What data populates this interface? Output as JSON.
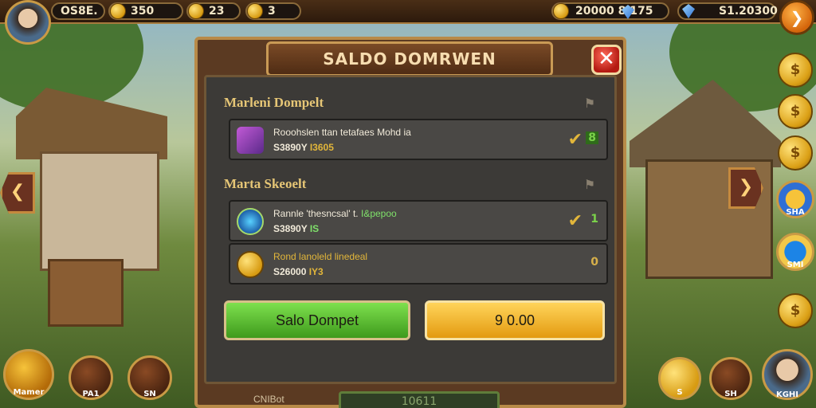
{
  "topbar": {
    "player_name": "OS8E.",
    "currency1": "350",
    "currency2": "23",
    "currency3": "3",
    "gold_total": "20000",
    "gem_count": "8",
    "gem_value": "175",
    "bank": "S1.20300"
  },
  "panel": {
    "title": "SALDO DOMRWEN",
    "close_icon": "✕",
    "section1_title": "Marleni Dompelt",
    "section2_title": "Marta Skeoelt",
    "rows": [
      {
        "line1": "Rooohslen ttan tetafaes Mohd ia",
        "line2": "S3890Y",
        "line2_accent": "I3605",
        "check": "✔",
        "flag": "8"
      },
      {
        "line1": "Rannle 'thesncsal' t.",
        "line1_accent": "I&pepoo",
        "line2": "S3890Y",
        "line2_accent": "IS",
        "check": "✔",
        "flag": "1"
      },
      {
        "line1": "Rond lanoleld linedeal",
        "line2": "S26000",
        "line2_accent": "IY3",
        "check": "",
        "flag": "0"
      }
    ],
    "primary_button": "Salo Dompet",
    "amount_button": "9 0.00",
    "progress_label": "10611",
    "footer_label": "CNIBot"
  },
  "bottom": {
    "left1_label": "Mamer",
    "left2_label": "PA1",
    "left3_label": "SN",
    "right1_label": "S",
    "right2_label": "SH",
    "right3_label": "KGHI"
  },
  "sidebar": {
    "badge1_label": "SHA",
    "badge2_label": "SMI"
  },
  "colors": {
    "accent_gold": "#e6c676",
    "green_button": "#4fb52a",
    "gold_button": "#f2b21e"
  }
}
